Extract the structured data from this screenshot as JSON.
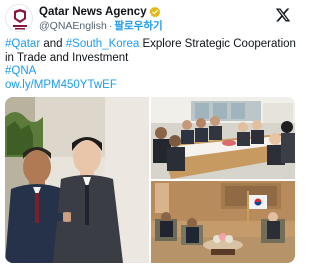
{
  "tweet": {
    "author": {
      "display_name": "Qatar News Agency",
      "handle": "@QNAEnglish",
      "separator": "·",
      "follow_label": "팔로우하기",
      "logo_icon": "qna-logo-icon",
      "verified_icon": "verified-badge-icon"
    },
    "brand_icon": "x-logo-icon",
    "text": {
      "hashtag_qatar": "#Qatar",
      "and": " and ",
      "hashtag_south_korea": "#South_Korea",
      "rest_line1": " Explore Strategic Cooperation",
      "line2": "in Trade and Investment",
      "hashtag_qna": "#QNA",
      "link": "ow.ly/MPM450YTwEF"
    },
    "media": {
      "count": 3
    }
  },
  "colors": {
    "link": "#1d9bf0",
    "verified": "#e2b719",
    "text": "#0f1419",
    "secondary": "#536471"
  }
}
